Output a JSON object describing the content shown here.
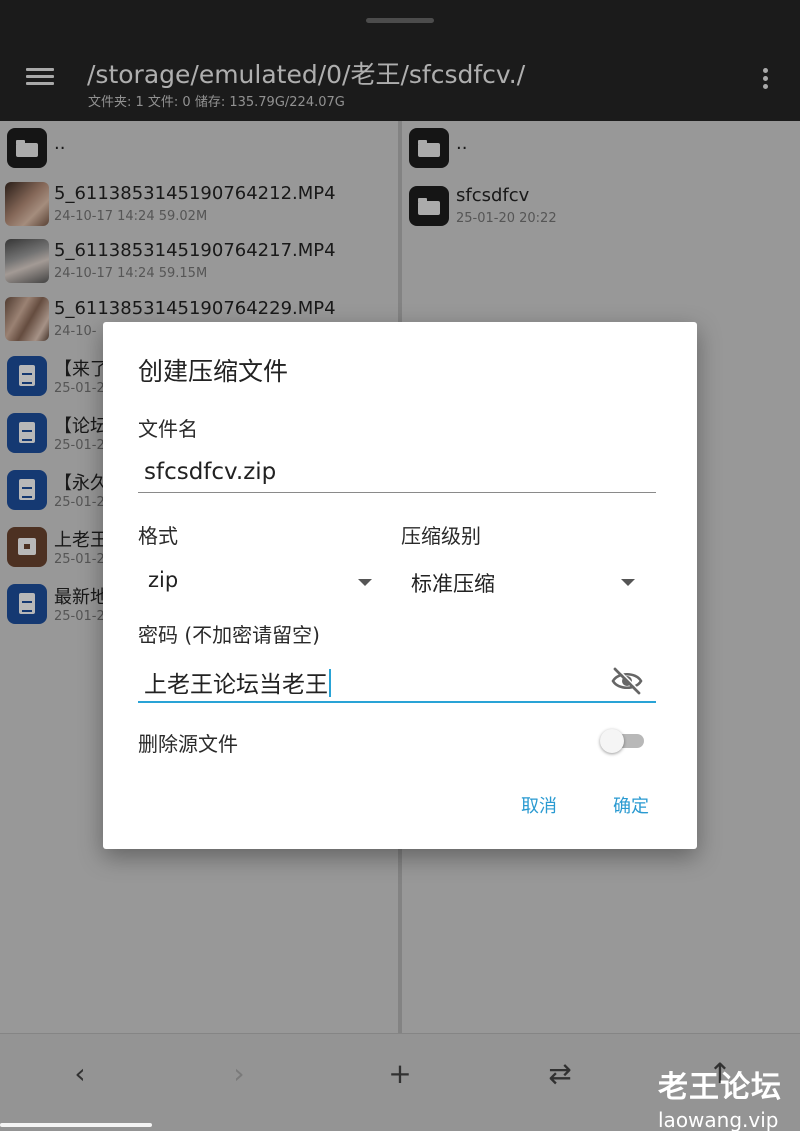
{
  "header": {
    "path": "/storage/emulated/0/老王/sfcsdfcv./",
    "info": "文件夹: 1  文件: 0  储存: 135.79G/224.07G"
  },
  "left_pane": {
    "parent": "..",
    "files": [
      {
        "name": "5_6113853145190764212.MP4",
        "meta": "24-10-17 14:24  59.02M"
      },
      {
        "name": "5_6113853145190764217.MP4",
        "meta": "24-10-17 14:24  59.15M"
      },
      {
        "name": "5_6113853145190764229.MP4",
        "meta": "24-10-"
      },
      {
        "name": "【来了",
        "meta": "25-01-2"
      },
      {
        "name": "【论坛",
        "meta": "25-01-2"
      },
      {
        "name": "【永久",
        "meta": "25-01-2"
      },
      {
        "name": "上老王",
        "meta": "25-01-2"
      },
      {
        "name": "最新地",
        "meta": "25-01-2"
      }
    ]
  },
  "right_pane": {
    "parent": "..",
    "files": [
      {
        "name": "sfcsdfcv",
        "meta": "25-01-20 20:22"
      }
    ]
  },
  "dialog": {
    "title": "创建压缩文件",
    "filename_label": "文件名",
    "filename_value": "sfcsdfcv.zip",
    "format_label": "格式",
    "format_value": "zip",
    "level_label": "压缩级别",
    "level_value": "标准压缩",
    "password_label": "密码 (不加密请留空)",
    "password_value": "上老王论坛当老王",
    "delete_source_label": "删除源文件",
    "delete_source_on": false,
    "cancel_label": "取消",
    "ok_label": "确定"
  },
  "toolbar": {
    "back_icon": "‹",
    "forward_icon": "›",
    "add_icon": "+",
    "swap_icon": "⇄",
    "up_icon": "↑"
  },
  "watermark": {
    "name": "老王论坛",
    "url": "laowang.vip"
  },
  "colors": {
    "accent": "#29a3d6",
    "topbar": "#262626"
  }
}
